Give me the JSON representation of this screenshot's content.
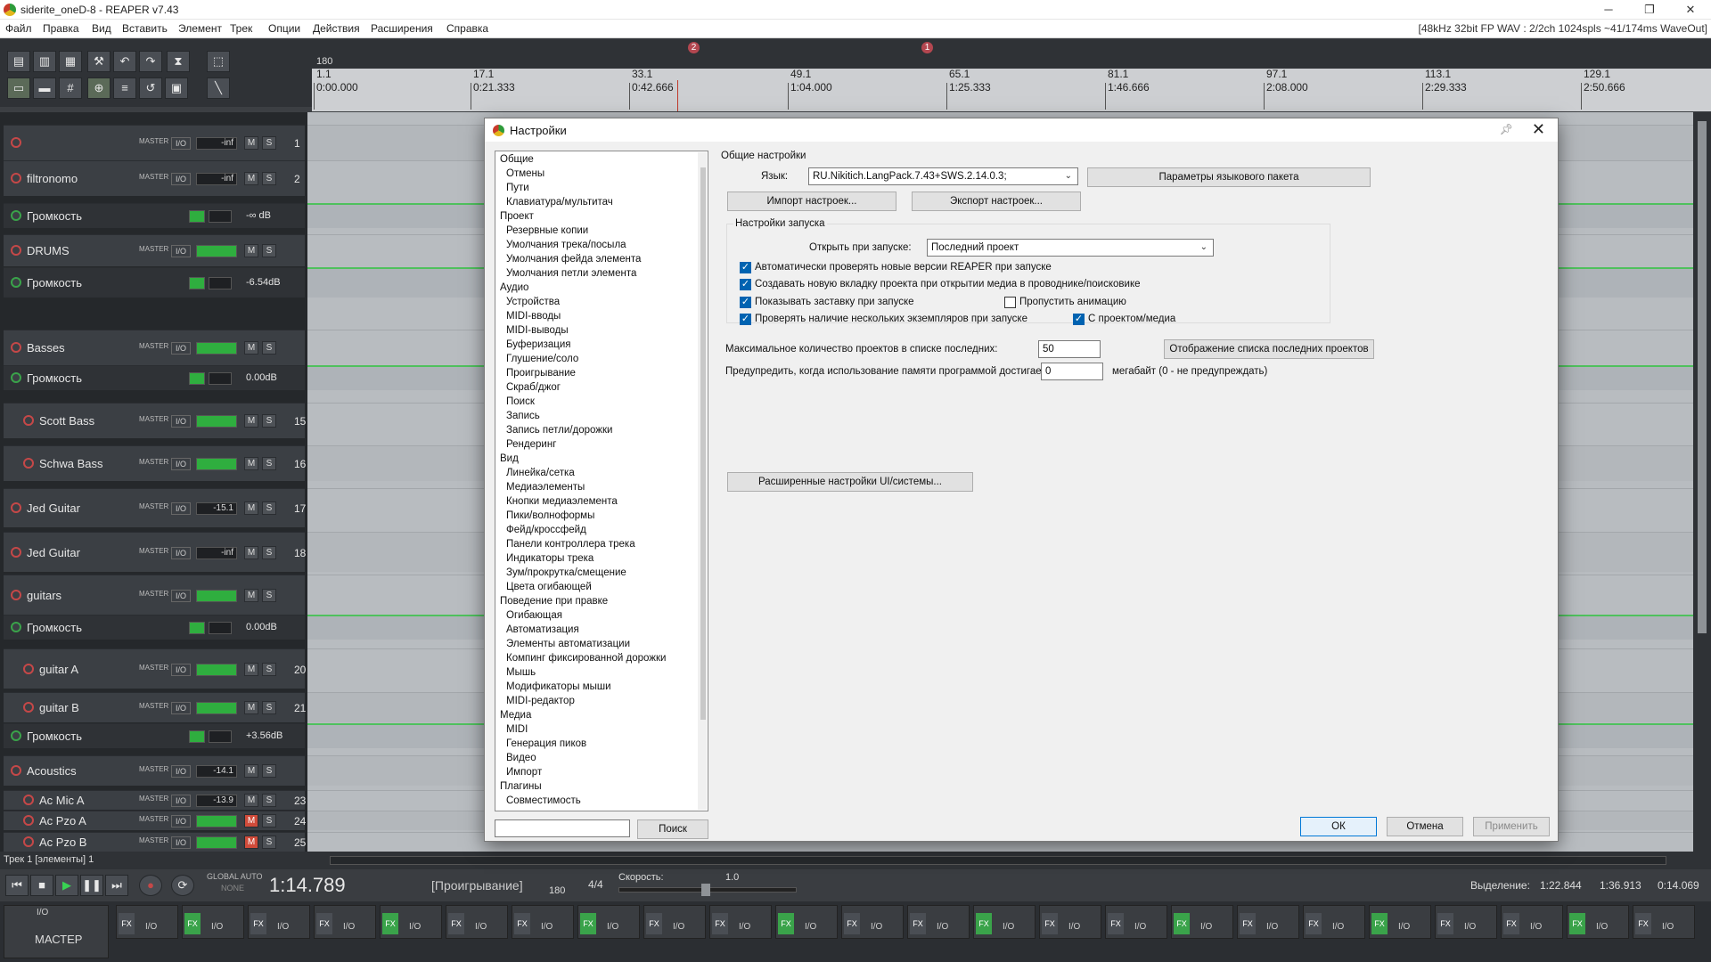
{
  "window": {
    "title": "siderite_oneD-8 - REAPER v7.43",
    "audio_status": "[48kHz 32bit FP WAV : 2/2ch 1024spls ~41/174ms WaveOut]"
  },
  "menu": [
    "Файл",
    "Правка",
    "Вид",
    "Вставить",
    "Элемент",
    "Трек",
    "Опции",
    "Действия",
    "Расширения",
    "Справка"
  ],
  "ruler": {
    "tempo": "180",
    "marks": [
      {
        "bar": "1.1",
        "time": "0:00.000"
      },
      {
        "bar": "17.1",
        "time": "0:21.333"
      },
      {
        "bar": "33.1",
        "time": "0:42.666"
      },
      {
        "bar": "49.1",
        "time": "1:04.000"
      },
      {
        "bar": "65.1",
        "time": "1:25.333"
      },
      {
        "bar": "81.1",
        "time": "1:46.666"
      },
      {
        "bar": "97.1",
        "time": "2:08.000"
      },
      {
        "bar": "113.1",
        "time": "2:29.333"
      },
      {
        "bar": "129.1",
        "time": "2:50.666"
      }
    ],
    "markers": [
      "2",
      "1"
    ]
  },
  "tracks": [
    {
      "name": "",
      "vol": "-inf",
      "num": "1",
      "env": false
    },
    {
      "name": "filtronomo",
      "vol": "-inf",
      "num": "2",
      "env": false
    },
    {
      "name": "Громкость",
      "vol": "-∞ dB",
      "num": "",
      "env": true
    },
    {
      "name": "DRUMS",
      "vol": "",
      "num": "",
      "env": false
    },
    {
      "name": "Громкость",
      "vol": "-6.54dB",
      "num": "",
      "env": true
    },
    {
      "name": "Basses",
      "vol": "",
      "num": "",
      "env": false
    },
    {
      "name": "Громкость",
      "vol": "0.00dB",
      "num": "",
      "env": true
    },
    {
      "name": "Scott Bass",
      "vol": "",
      "num": "15",
      "env": false
    },
    {
      "name": "Schwa Bass",
      "vol": "",
      "num": "16",
      "env": false
    },
    {
      "name": "Jed Guitar",
      "vol": "-15.1",
      "num": "17",
      "env": false
    },
    {
      "name": "Jed Guitar",
      "vol": "-inf",
      "num": "18",
      "env": false
    },
    {
      "name": "guitars",
      "vol": "",
      "num": "",
      "env": false
    },
    {
      "name": "Громкость",
      "vol": "0.00dB",
      "num": "",
      "env": true
    },
    {
      "name": "guitar A",
      "vol": "",
      "num": "20",
      "env": false
    },
    {
      "name": "guitar B",
      "vol": "",
      "num": "21",
      "env": false
    },
    {
      "name": "Громкость",
      "vol": "+3.56dB",
      "num": "",
      "env": true
    },
    {
      "name": "Acoustics",
      "vol": "-14.1",
      "num": "",
      "env": false
    },
    {
      "name": "Ac Mic A",
      "vol": "-13.9",
      "num": "23",
      "env": false
    },
    {
      "name": "Ac Pzo A",
      "vol": "",
      "num": "24",
      "env": false
    },
    {
      "name": "Ac Pzo B",
      "vol": "",
      "num": "25",
      "env": false
    }
  ],
  "track_labels": {
    "master": "MASTER",
    "io": "I/O",
    "mute": "M",
    "solo": "S"
  },
  "status_bar": {
    "left": "Трек 1 [элементы] 1"
  },
  "transport": {
    "time": "1:14.789",
    "state": "[Проигрывание]",
    "global_auto": "GLOBAL AUTO",
    "none": "NONE",
    "bpm": "180",
    "sig": "4/4",
    "rate_label": "Скорость:",
    "rate_value": "1.0",
    "selection_label": "Выделение:",
    "sel_start": "1:22.844",
    "sel_end": "1:36.913",
    "sel_len": "0:14.069"
  },
  "mixer": {
    "master_label": "МАСТЕР",
    "io": "I/O"
  },
  "dialog": {
    "title": "Настройки",
    "tree": [
      {
        "label": "Общие",
        "level": 0
      },
      {
        "label": "Отмены",
        "level": 1
      },
      {
        "label": "Пути",
        "level": 1
      },
      {
        "label": "Клавиатура/мультитач",
        "level": 1
      },
      {
        "label": "Проект",
        "level": 0
      },
      {
        "label": "Резервные копии",
        "level": 1
      },
      {
        "label": "Умолчания трека/посыла",
        "level": 1
      },
      {
        "label": "Умолчания фейда элемента",
        "level": 1
      },
      {
        "label": "Умолчания петли элемента",
        "level": 1
      },
      {
        "label": "Аудио",
        "level": 0
      },
      {
        "label": "Устройства",
        "level": 1
      },
      {
        "label": "MIDI-вводы",
        "level": 1
      },
      {
        "label": "MIDI-выводы",
        "level": 1
      },
      {
        "label": "Буферизация",
        "level": 1
      },
      {
        "label": "Глушение/соло",
        "level": 1
      },
      {
        "label": "Проигрывание",
        "level": 1
      },
      {
        "label": "Скраб/джог",
        "level": 1
      },
      {
        "label": "Поиск",
        "level": 1
      },
      {
        "label": "Запись",
        "level": 1
      },
      {
        "label": "Запись петли/дорожки",
        "level": 1
      },
      {
        "label": "Рендеринг",
        "level": 1
      },
      {
        "label": "Вид",
        "level": 0
      },
      {
        "label": "Линейка/сетка",
        "level": 1
      },
      {
        "label": "Медиаэлементы",
        "level": 1
      },
      {
        "label": "Кнопки медиаэлемента",
        "level": 1
      },
      {
        "label": "Пики/волноформы",
        "level": 1
      },
      {
        "label": "Фейд/кроссфейд",
        "level": 1
      },
      {
        "label": "Панели контроллера трека",
        "level": 1
      },
      {
        "label": "Индикаторы трека",
        "level": 1
      },
      {
        "label": "Зум/прокрутка/смещение",
        "level": 1
      },
      {
        "label": "Цвета огибающей",
        "level": 1
      },
      {
        "label": "Поведение при правке",
        "level": 0
      },
      {
        "label": "Огибающая",
        "level": 1
      },
      {
        "label": "Автоматизация",
        "level": 1
      },
      {
        "label": "Элементы автоматизации",
        "level": 1
      },
      {
        "label": "Компинг фиксированной дорожки",
        "level": 1
      },
      {
        "label": "Мышь",
        "level": 1
      },
      {
        "label": "Модификаторы мыши",
        "level": 1
      },
      {
        "label": "MIDI-редактор",
        "level": 1
      },
      {
        "label": "Медиа",
        "level": 0
      },
      {
        "label": "MIDI",
        "level": 1
      },
      {
        "label": "Генерация пиков",
        "level": 1
      },
      {
        "label": "Видео",
        "level": 1
      },
      {
        "label": "Импорт",
        "level": 1
      },
      {
        "label": "Плагины",
        "level": 0
      },
      {
        "label": "Совместимость",
        "level": 1
      }
    ],
    "search_button": "Поиск",
    "search_value": "",
    "section_title": "Общие настройки",
    "language_label": "Язык:",
    "language_value": "RU.Nikitich.LangPack.7.43+SWS.2.14.0.3;",
    "langpack_button": "Параметры языкового пакета",
    "import_button": "Импорт настроек...",
    "export_button": "Экспорт настроек...",
    "startup_group": "Настройки запуска",
    "open_on_start_label": "Открыть при запуске:",
    "open_on_start_value": "Последний проект",
    "checks": {
      "check_updates": {
        "label": "Автоматически проверять новые версии REAPER при запуске",
        "checked": true
      },
      "new_tab": {
        "label": "Создавать новую вкладку проекта при открытии медиа в проводнике/поисковике",
        "checked": true
      },
      "splash": {
        "label": "Показывать заставку при запуске",
        "checked": true
      },
      "skip_anim": {
        "label": "Пропустить анимацию",
        "checked": false
      },
      "multi_instance": {
        "label": "Проверять наличие нескольких экземпляров при запуске",
        "checked": true
      },
      "with_project": {
        "label": "С проектом/медиа",
        "checked": true
      }
    },
    "max_recent_label": "Максимальное количество проектов в списке последних:",
    "max_recent_value": "50",
    "recent_button": "Отображение списка последних проектов",
    "mem_warn_label": "Предупредить, когда использование памяти программой достигает",
    "mem_warn_value": "0",
    "mem_warn_suffix": "мегабайт (0 - не предупреждать)",
    "advanced_button": "Расширенные настройки UI/системы...",
    "ok": "ОК",
    "cancel": "Отмена",
    "apply": "Применить"
  }
}
